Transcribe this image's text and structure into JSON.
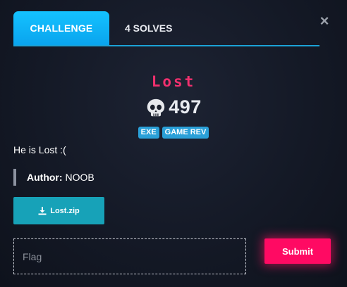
{
  "tabs": {
    "challenge_label": "CHALLENGE",
    "solves_label": "4 SOLVES"
  },
  "close": {
    "glyph": "×",
    "icon": "close-icon"
  },
  "challenge": {
    "title": "Lost",
    "points": "497",
    "points_icon": "skull-icon",
    "tags": [
      "EXE",
      "GAME REV"
    ],
    "description": "He is Lost :(",
    "author_label": "Author:",
    "author_name": "NOOB",
    "file": {
      "name": "Lost.zip",
      "icon": "download-icon"
    }
  },
  "submission": {
    "placeholder": "Flag",
    "value": "",
    "submit_label": "Submit"
  },
  "colors": {
    "accent": "#14c2ff",
    "title": "#f0306e",
    "tag": "#2aa0d8",
    "download": "#17a2b8",
    "submit": "#ff0a63"
  }
}
